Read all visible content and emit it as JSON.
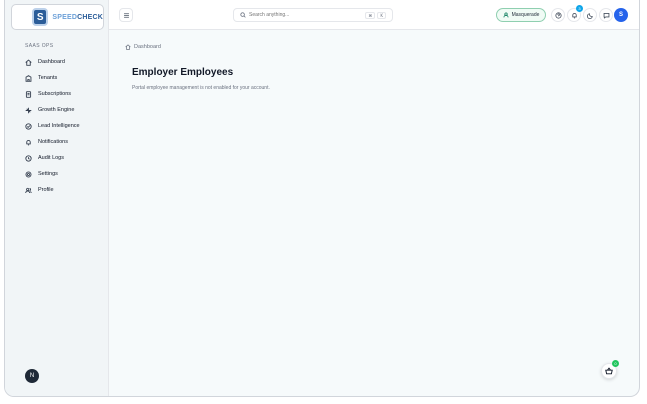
{
  "logo": {
    "part_a": "SPEED",
    "part_b": "CHECK"
  },
  "sidebar": {
    "section_label": "SAAS OPS",
    "items": [
      {
        "label": "Dashboard",
        "icon": "home-icon"
      },
      {
        "label": "Tenants",
        "icon": "building-icon"
      },
      {
        "label": "Subscriptions",
        "icon": "receipt-icon"
      },
      {
        "label": "Growth Engine",
        "icon": "sparkle-icon"
      },
      {
        "label": "Lead Intelligence",
        "icon": "target-icon"
      },
      {
        "label": "Notifications",
        "icon": "bell-icon"
      },
      {
        "label": "Audit Logs",
        "icon": "clock-icon"
      },
      {
        "label": "Settings",
        "icon": "gear-icon"
      },
      {
        "label": "Profile",
        "icon": "users-icon"
      }
    ],
    "bottom_button": "N"
  },
  "topbar": {
    "search_placeholder": "Search anything...",
    "kbd_1": "⌘",
    "kbd_2": "K",
    "masquerade_label": "Masquerade",
    "notification_count": "3",
    "avatar_initial": "S"
  },
  "main": {
    "breadcrumb": "Dashboard",
    "title": "Employer Employees",
    "message": "Portal employee management is not enabled for your account."
  },
  "fab": {
    "badge": "0"
  }
}
